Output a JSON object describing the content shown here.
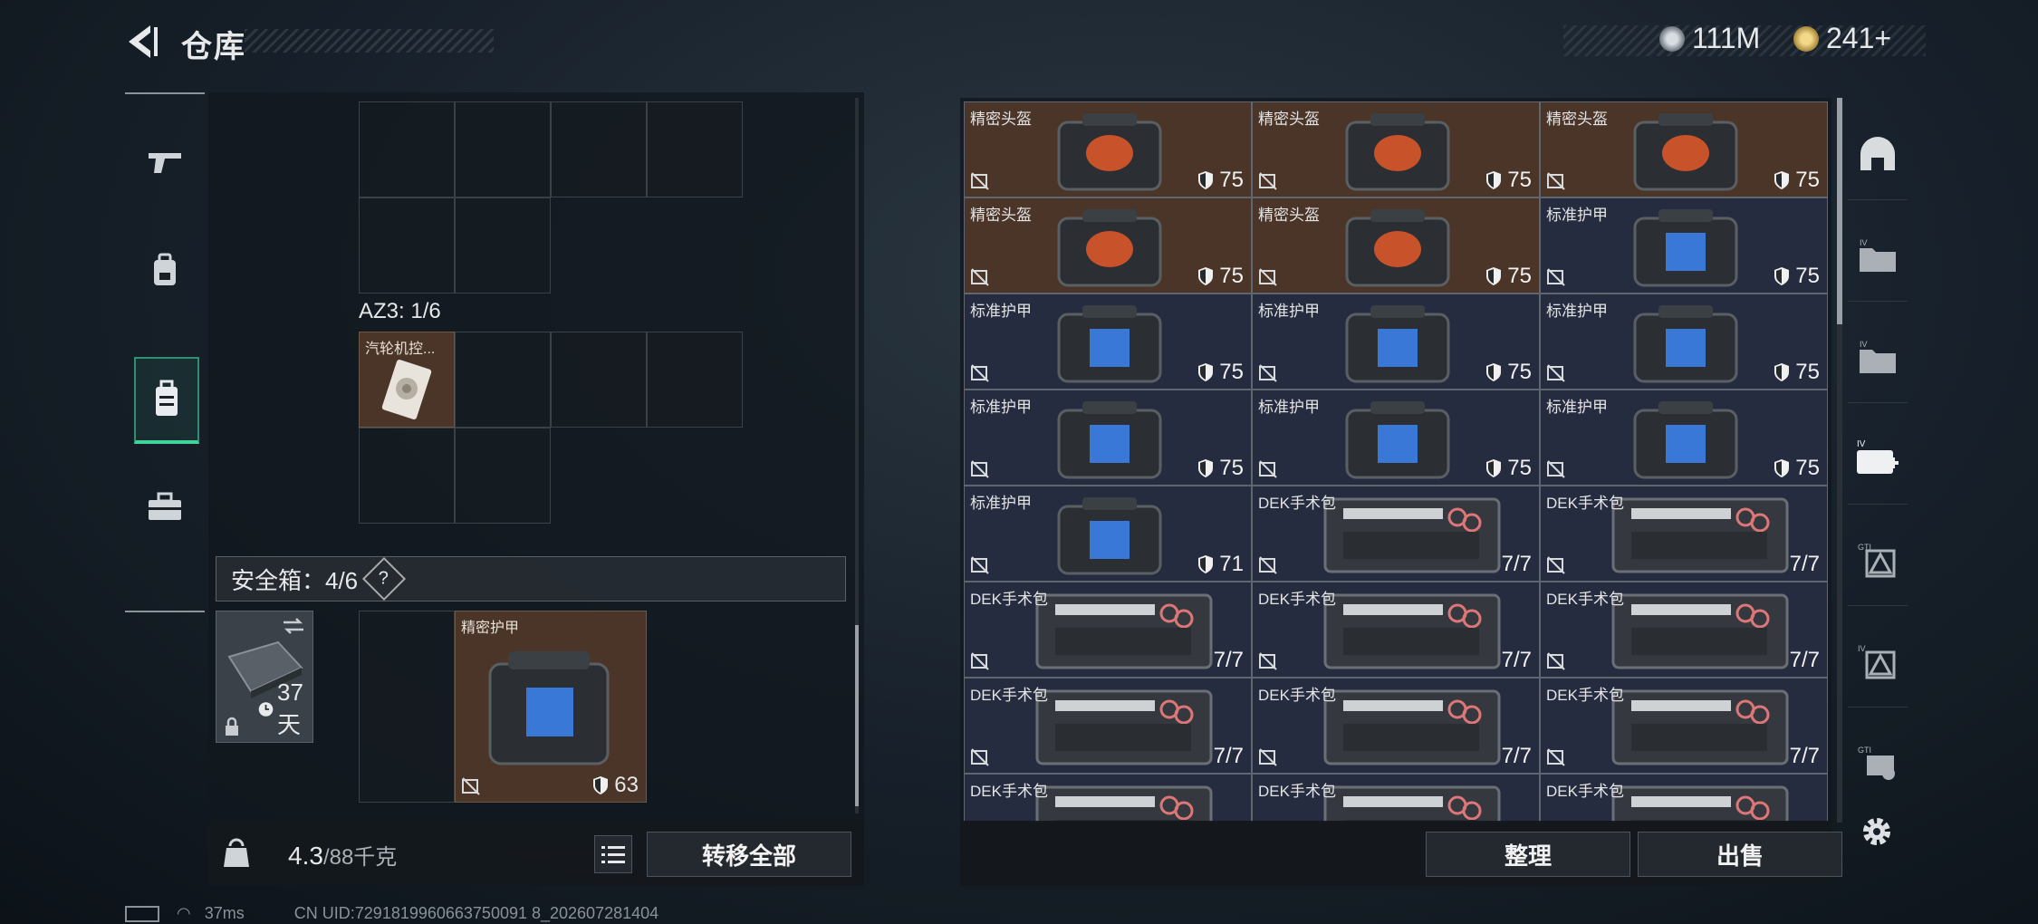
{
  "header": {
    "title": "仓库",
    "currency1": "111M",
    "currency2": "241+"
  },
  "nav": [
    "weapon-icon",
    "backpack-icon",
    "vest-icon",
    "toolbox-icon"
  ],
  "left": {
    "az_label": "AZ3: 1/6",
    "az_item_name": "汽轮机控...",
    "safe_label": "安全箱：4/6",
    "safe_help": "?",
    "case_days": "37天",
    "case_item_name": "精密护甲",
    "case_item_value": "63",
    "weight": "4.3",
    "weight_max": "/88千克",
    "transfer_label": "转移全部"
  },
  "items": [
    {
      "name": "精密头盔",
      "value": "75",
      "kind": "gold"
    },
    {
      "name": "精密头盔",
      "value": "75",
      "kind": "gold"
    },
    {
      "name": "精密头盔",
      "value": "75",
      "kind": "gold"
    },
    {
      "name": "精密头盔",
      "value": "75",
      "kind": "gold"
    },
    {
      "name": "精密头盔",
      "value": "75",
      "kind": "gold"
    },
    {
      "name": "标准护甲",
      "value": "75",
      "kind": "blue"
    },
    {
      "name": "标准护甲",
      "value": "75",
      "kind": "blue"
    },
    {
      "name": "标准护甲",
      "value": "75",
      "kind": "blue"
    },
    {
      "name": "标准护甲",
      "value": "75",
      "kind": "blue"
    },
    {
      "name": "标准护甲",
      "value": "75",
      "kind": "blue"
    },
    {
      "name": "标准护甲",
      "value": "75",
      "kind": "blue"
    },
    {
      "name": "标准护甲",
      "value": "75",
      "kind": "blue"
    },
    {
      "name": "标准护甲",
      "value": "71",
      "kind": "blue"
    },
    {
      "name": "DEK手术包",
      "value": "7/7",
      "kind": "blue"
    },
    {
      "name": "DEK手术包",
      "value": "7/7",
      "kind": "blue"
    },
    {
      "name": "DEK手术包",
      "value": "7/7",
      "kind": "blue"
    },
    {
      "name": "DEK手术包",
      "value": "7/7",
      "kind": "blue"
    },
    {
      "name": "DEK手术包",
      "value": "7/7",
      "kind": "blue"
    },
    {
      "name": "DEK手术包",
      "value": "7/7",
      "kind": "blue"
    },
    {
      "name": "DEK手术包",
      "value": "7/7",
      "kind": "blue"
    },
    {
      "name": "DEK手术包",
      "value": "7/7",
      "kind": "blue"
    },
    {
      "name": "DEK手术包",
      "value": "",
      "kind": "blue"
    },
    {
      "name": "DEK手术包",
      "value": "",
      "kind": "blue"
    },
    {
      "name": "DEK手术包",
      "value": "",
      "kind": "blue"
    }
  ],
  "right_buttons": {
    "sort": "整理",
    "sell": "出售"
  },
  "status": {
    "ping": "37ms",
    "uid": "CN UID:7291819960663750091 8_202607281404"
  }
}
